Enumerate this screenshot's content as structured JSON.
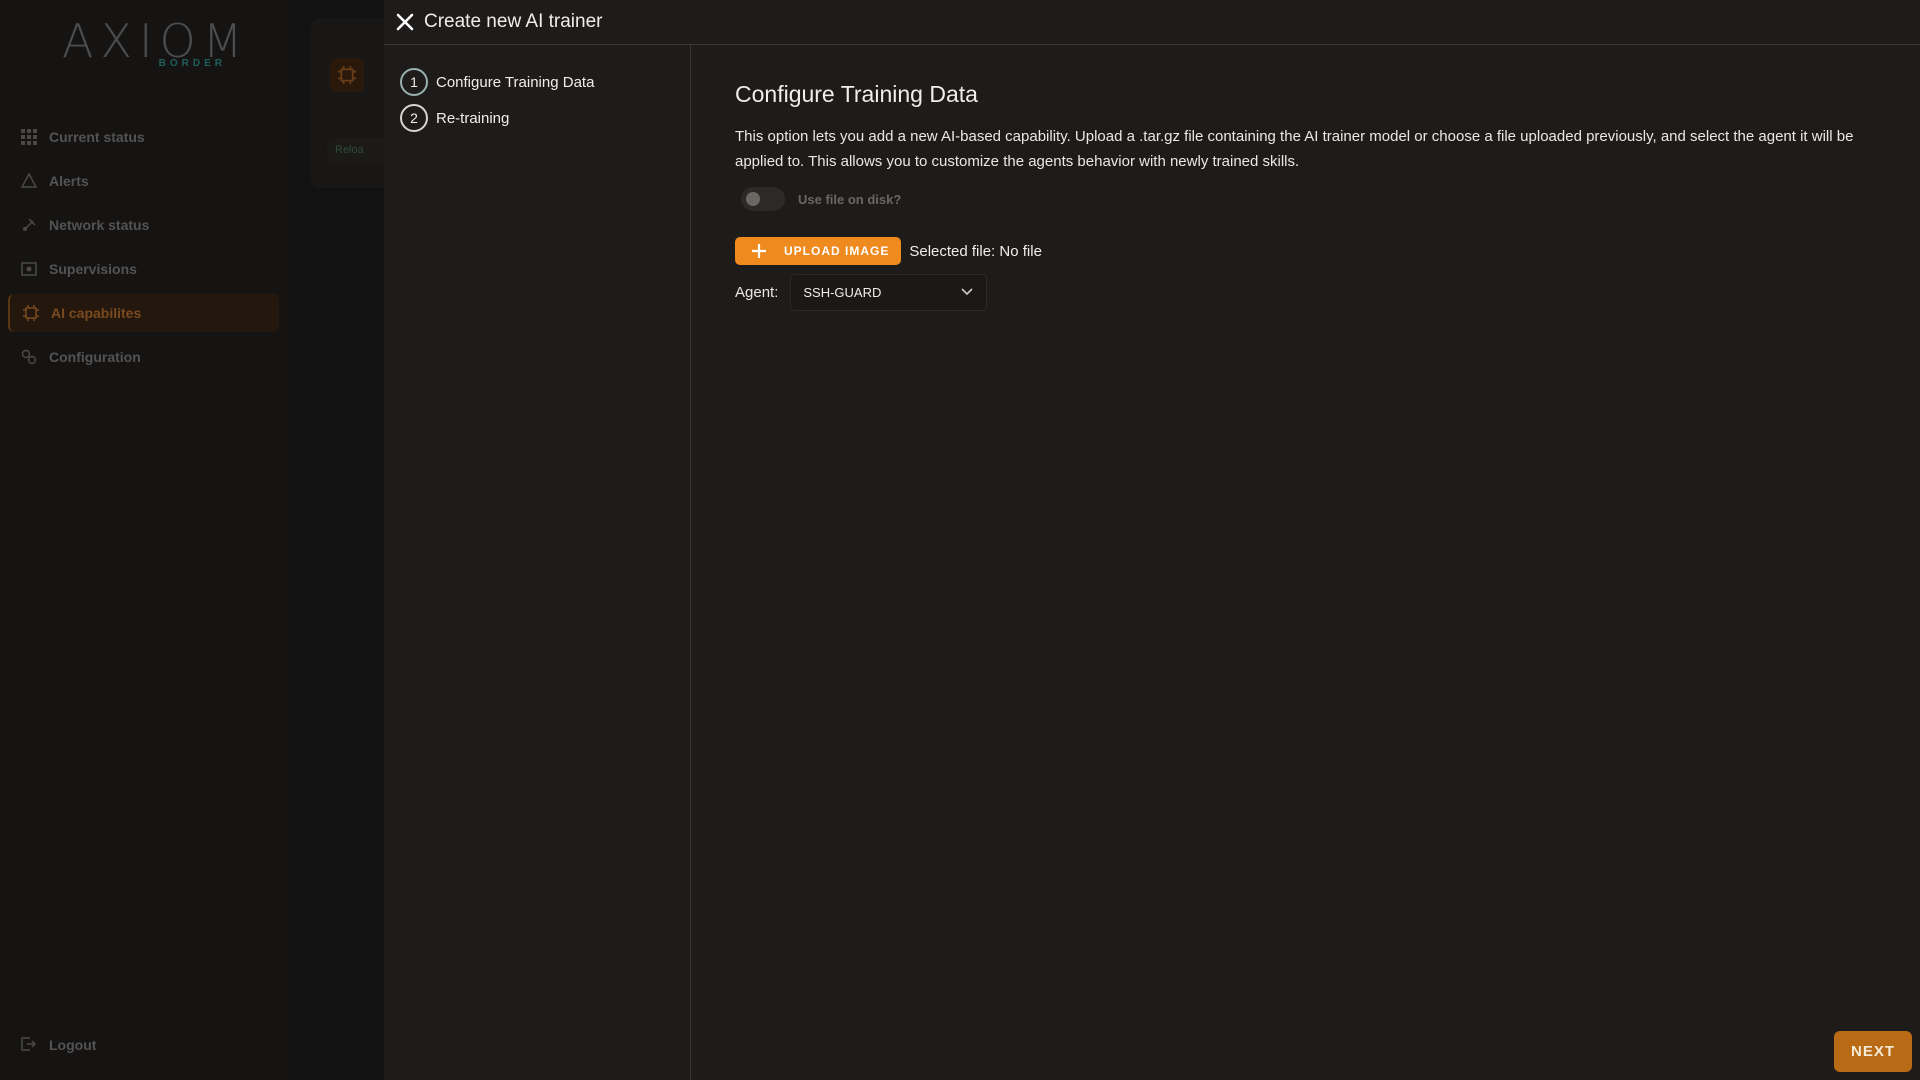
{
  "app": {
    "logo_text": "AXIOM",
    "logo_sub": "BORDER"
  },
  "sidebar": {
    "items": [
      {
        "label": "Current status",
        "icon": "grid-icon"
      },
      {
        "label": "Alerts",
        "icon": "warning-icon"
      },
      {
        "label": "Network status",
        "icon": "network-icon"
      },
      {
        "label": "Supervisions",
        "icon": "supervision-icon"
      },
      {
        "label": "AI capabilites",
        "icon": "ai-icon",
        "active": true
      },
      {
        "label": "Configuration",
        "icon": "configuration-icon"
      }
    ],
    "logout_label": "Logout"
  },
  "background": {
    "chip_label": "Reloa"
  },
  "modal": {
    "title": "Create new AI trainer",
    "steps": [
      {
        "number": "1",
        "label": "Configure Training Data"
      },
      {
        "number": "2",
        "label": "Re-training"
      }
    ],
    "section_title": "Configure Training Data",
    "description": "This option lets you add a new AI-based capability. Upload a .tar.gz file containing the AI trainer model or choose a file uploaded previously, and select the agent it will be applied to. This allows you to customize the agents behavior with newly trained skills.",
    "toggle_label": "Use file on disk?",
    "upload_label": "UPLOAD IMAGE",
    "selected_file": "Selected file: No file",
    "agent_label": "Agent:",
    "agent_value": "SSH-GUARD",
    "next_label": "NEXT"
  },
  "colors": {
    "accent": "#ee8a1e",
    "next_button": "#b86a15",
    "background": "#1e1c1b"
  }
}
